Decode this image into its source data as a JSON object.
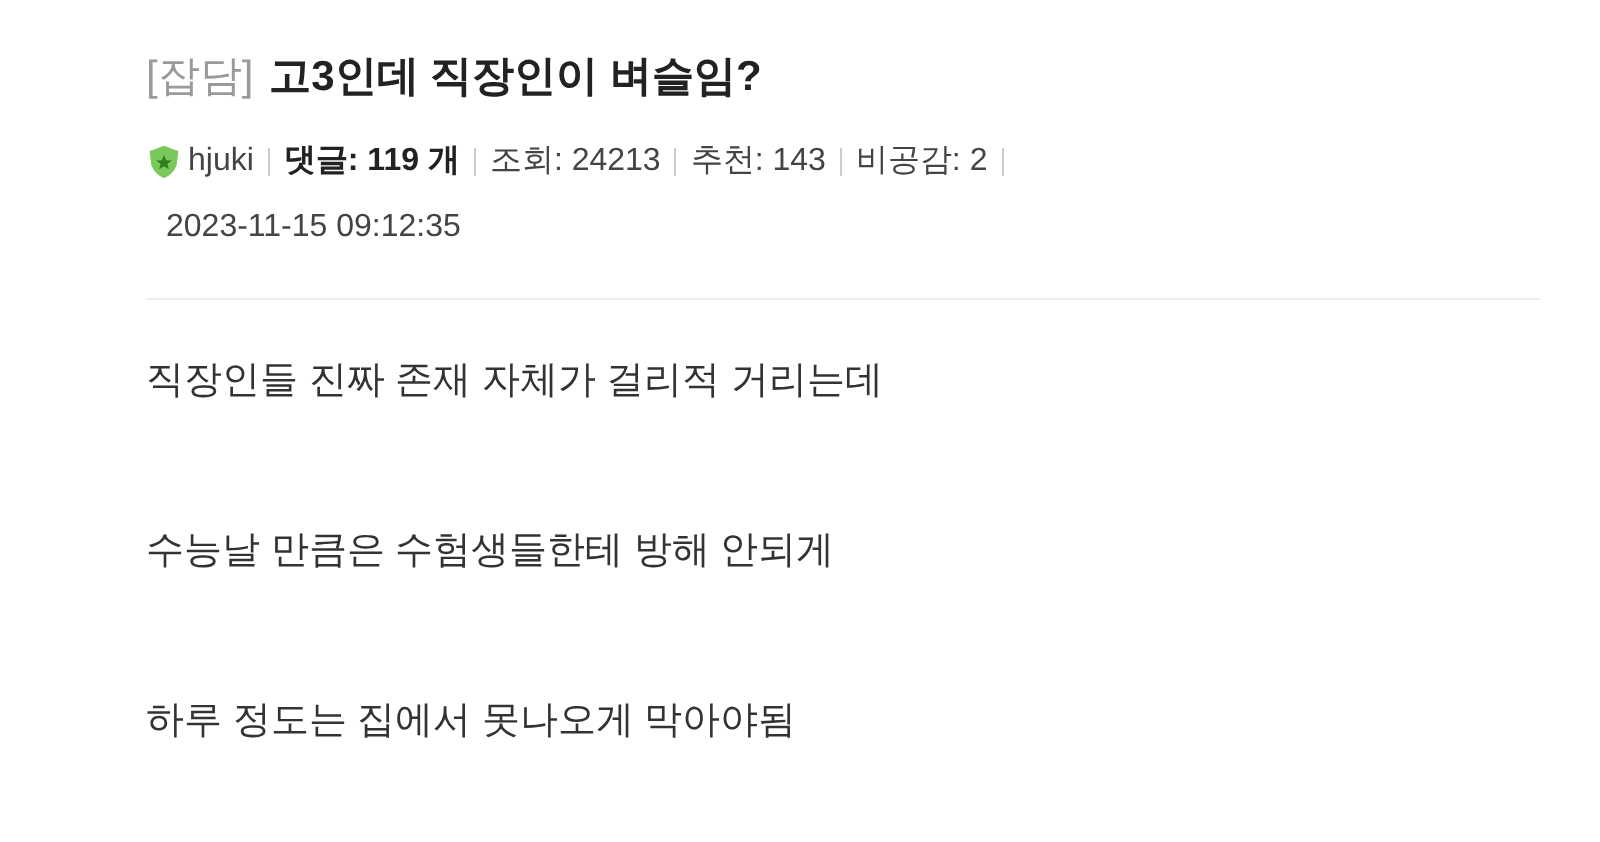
{
  "post": {
    "category": "[잡담]",
    "title": "고3인데 직장인이 벼슬임?",
    "author": "hjuki",
    "stats": [
      {
        "text": "댓글: 119 개",
        "emphasized": true
      },
      {
        "text": "조회: 24213",
        "emphasized": false
      },
      {
        "text": "추천: 143",
        "emphasized": false
      },
      {
        "text": "비공감: 2",
        "emphasized": false
      }
    ],
    "date": "2023-11-15 09:12:35",
    "body": [
      "직장인들 진짜 존재 자체가 걸리적 거리는데",
      "수능날 만큼은 수험생들한테 방해 안되게",
      "하루 정도는 집에서 못나오게 막아야됨"
    ]
  }
}
